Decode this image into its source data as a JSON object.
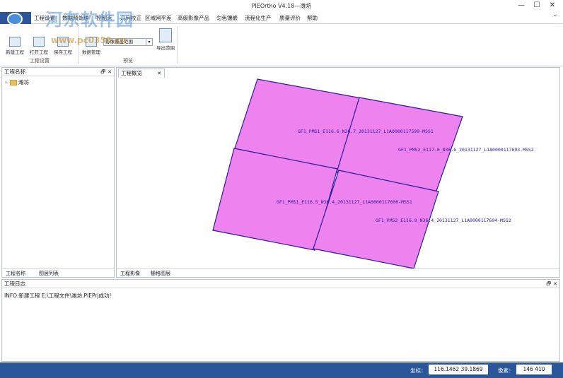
{
  "titlebar": {
    "title": "PIEOrtho V4.18—潍坊",
    "minimize": "—",
    "maximize": "☐",
    "close": "✕"
  },
  "ribbon_tabs": [
    "工程设置",
    "数据预处理",
    "控制点",
    "几何校正",
    "区域网平差",
    "高级影像产品",
    "匀色镶嵌",
    "流程化生产",
    "质量评价",
    "帮助"
  ],
  "ribbon_collapse": "⌃",
  "ribbon": {
    "buttons": [
      "新建工程",
      "打开工程",
      "保存工程",
      "数据管理",
      "导出范围"
    ],
    "combo_value": "影像覆盖范围",
    "group1_label": "工程设置",
    "group2_label": "预览"
  },
  "watermark": {
    "line1": "河东软件园",
    "line2": "www.pc0359.cn"
  },
  "left_panel": {
    "header": "工程名称",
    "pin": "🗗",
    "close": "✕",
    "tree_root": "潍坊",
    "bottom_tabs": [
      "工程名称",
      "图层列表"
    ]
  },
  "map_panel": {
    "tab_label": "工程概览",
    "tab_close": "✕",
    "bottom_tabs": [
      "工程影像",
      "栅格图层"
    ],
    "fill_color": "#ee82ee",
    "line_color": "#2a1aa0",
    "label_color": "#2a1aa0",
    "scenes": [
      {
        "name": "GF1_PMS1_E116.6_N36.7_20131127_L1A0000117599-MSS1"
      },
      {
        "name": "GF1_PMS2_E117.0_N36.6_20131127_L1A0000117693-MSS2"
      },
      {
        "name": "GF1_PMS1_E116.5_N36.4_20131127_L1A0000117600-MSS1"
      },
      {
        "name": "GF1_PMS2_E116.9_N36.4_20131127_L1A0000117694-MSS2"
      }
    ]
  },
  "log_panel": {
    "header": "工程日志",
    "pin": "🗗",
    "close": "✕",
    "lines": [
      "INFO:新建工程 E:\\工程文件\\潍坊.PIEPrj成功!"
    ]
  },
  "statusbar": {
    "coord_label": "坐标：",
    "coord_value": "116.1462  39.1869",
    "pixel_label": "像素：",
    "pixel_value": "146  410"
  }
}
